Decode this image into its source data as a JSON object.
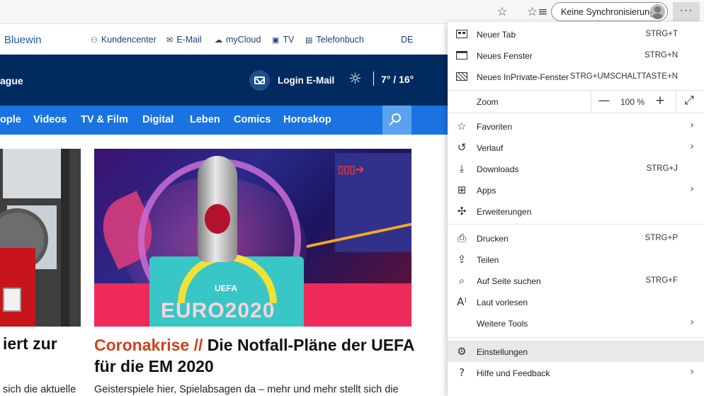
{
  "toolbar": {
    "star_icon": "star-icon",
    "favorites_icon": "favorites-list-icon",
    "sync_label": "Keine Synchronisierung",
    "more_label": "···"
  },
  "site": {
    "brand": "Bluewin",
    "top_links": [
      {
        "icon": "person-icon",
        "label": "Kundencenter"
      },
      {
        "icon": "mail-icon",
        "label": "E-Mail"
      },
      {
        "icon": "cloud-icon",
        "label": "myCloud"
      },
      {
        "icon": "tv-icon",
        "label": "TV"
      },
      {
        "icon": "phonebook-icon",
        "label": "Telefonbuch"
      }
    ],
    "lang": "DE",
    "band_text": "ague",
    "login_label": "Login E-Mail",
    "weather": "7° / 16°",
    "nav": [
      "ople",
      "Videos",
      "TV & Film",
      "Digital",
      "Leben",
      "Comics",
      "Horoskop"
    ],
    "left_headline": "iert zur",
    "left_teaser": "sich die aktuelle",
    "main_kicker": "Coronakrise //",
    "main_headline": "Die Notfall-Pläne der UEFA für die EM 2020",
    "main_teaser": "Geisterspiele hier, Spielabsagen da – mehr und mehr stellt sich die",
    "image_text": "EURO2020",
    "image_text_small": "UEFA"
  },
  "menu": {
    "items": [
      {
        "label": "Neuer Tab",
        "shortcut": "STRG+T",
        "icon": "new-tab-icon"
      },
      {
        "label": "Neues Fenster",
        "shortcut": "STRG+N",
        "icon": "new-window-icon"
      },
      {
        "label": "Neues InPrivate-Fenster",
        "shortcut": "STRG+UMSCHALTTASTE+N",
        "icon": "inprivate-icon"
      },
      {
        "label": "Favoriten",
        "shortcut": "",
        "icon": "favorites-star-icon"
      },
      {
        "label": "Verlauf",
        "shortcut": "",
        "icon": "history-icon"
      },
      {
        "label": "Downloads",
        "shortcut": "STRG+J",
        "icon": "download-icon"
      },
      {
        "label": "Apps",
        "shortcut": "",
        "icon": "apps-icon"
      },
      {
        "label": "Erweiterungen",
        "shortcut": "",
        "icon": "extensions-icon"
      },
      {
        "label": "Drucken",
        "shortcut": "STRG+P",
        "icon": "print-icon"
      },
      {
        "label": "Teilen",
        "shortcut": "",
        "icon": "share-icon"
      },
      {
        "label": "Auf Seite suchen",
        "shortcut": "STRG+F",
        "icon": "find-icon"
      },
      {
        "label": "Laut vorlesen",
        "shortcut": "",
        "icon": "read-aloud-icon"
      },
      {
        "label": "Weitere Tools",
        "shortcut": "",
        "icon": ""
      },
      {
        "label": "Einstellungen",
        "shortcut": "",
        "icon": "settings-icon"
      },
      {
        "label": "Hilfe und Feedback",
        "shortcut": "",
        "icon": "help-icon"
      }
    ],
    "zoom": {
      "label": "Zoom",
      "value": "100 %",
      "minus": "—",
      "plus": "+",
      "fullscreen": "⤢"
    },
    "arrow": "›"
  }
}
